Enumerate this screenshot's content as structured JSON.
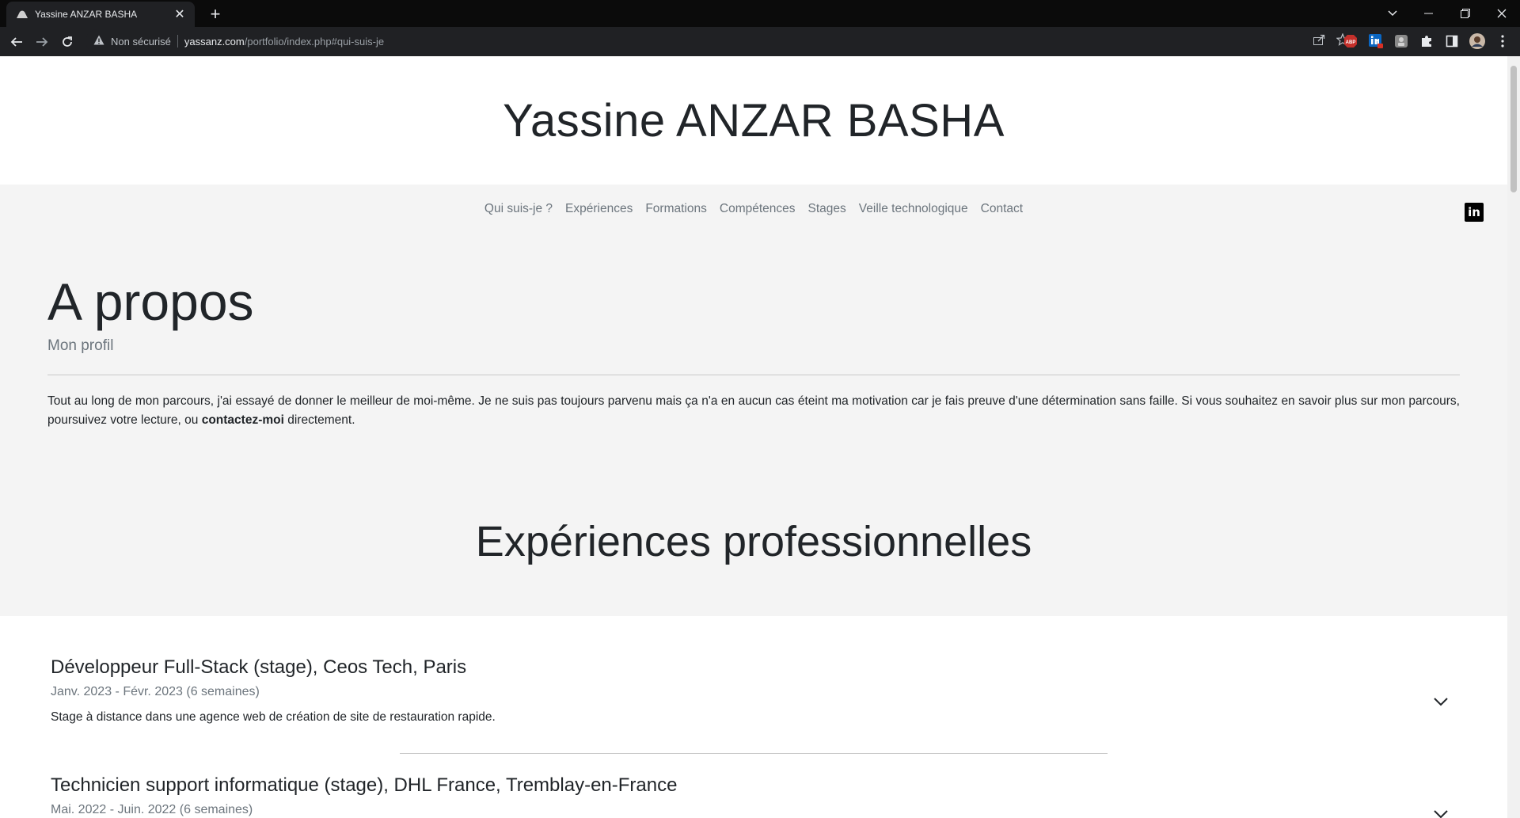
{
  "browser": {
    "tab_title": "Yassine ANZAR BASHA",
    "tab_close": "✕",
    "new_tab": "+",
    "security_label": "Non sécurisé",
    "url_host": "yassanz.com",
    "url_path": "/portfolio/index.php#qui-suis-je",
    "extensions": [
      "abp-extension-icon",
      "linkedin-extension-icon",
      "grey-extension-icon",
      "puzzle-icon",
      "side-panel-icon",
      "profile-avatar"
    ]
  },
  "site": {
    "name": "Yassine ANZAR BASHA",
    "nav": [
      "Qui suis-je ?",
      "Expériences",
      "Formations",
      "Compétences",
      "Stages",
      "Veille technologique",
      "Contact"
    ],
    "social": "in"
  },
  "about": {
    "title": "A propos",
    "subtitle": "Mon profil",
    "text_before": "Tout au long de mon parcours, j'ai essayé de donner le meilleur de moi-même. Je ne suis pas toujours parvenu mais ça n'a en aucun cas éteint ma motivation car je fais preuve d'une détermination sans faille. Si vous souhaitez en savoir plus sur mon parcours, poursuivez votre lecture, ou ",
    "text_link": "contactez-moi",
    "text_after": " directement."
  },
  "experiences": {
    "title": "Expériences professionnelles",
    "items": [
      {
        "title": "Développeur Full-Stack (stage), Ceos Tech, Paris",
        "date": "Janv. 2023 - Févr. 2023 (6 semaines)",
        "description": "Stage à distance dans une agence web de création de site de restauration rapide."
      },
      {
        "title": "Technicien support informatique (stage), DHL France, Tremblay-en-France",
        "date": "Mai. 2022 - Juin. 2022 (6 semaines)"
      }
    ]
  },
  "colors": {
    "chrome_dark": "#0b0b0b",
    "toolbar": "#202124",
    "grey_section": "#f4f4f4",
    "muted_text": "#6c757d"
  }
}
